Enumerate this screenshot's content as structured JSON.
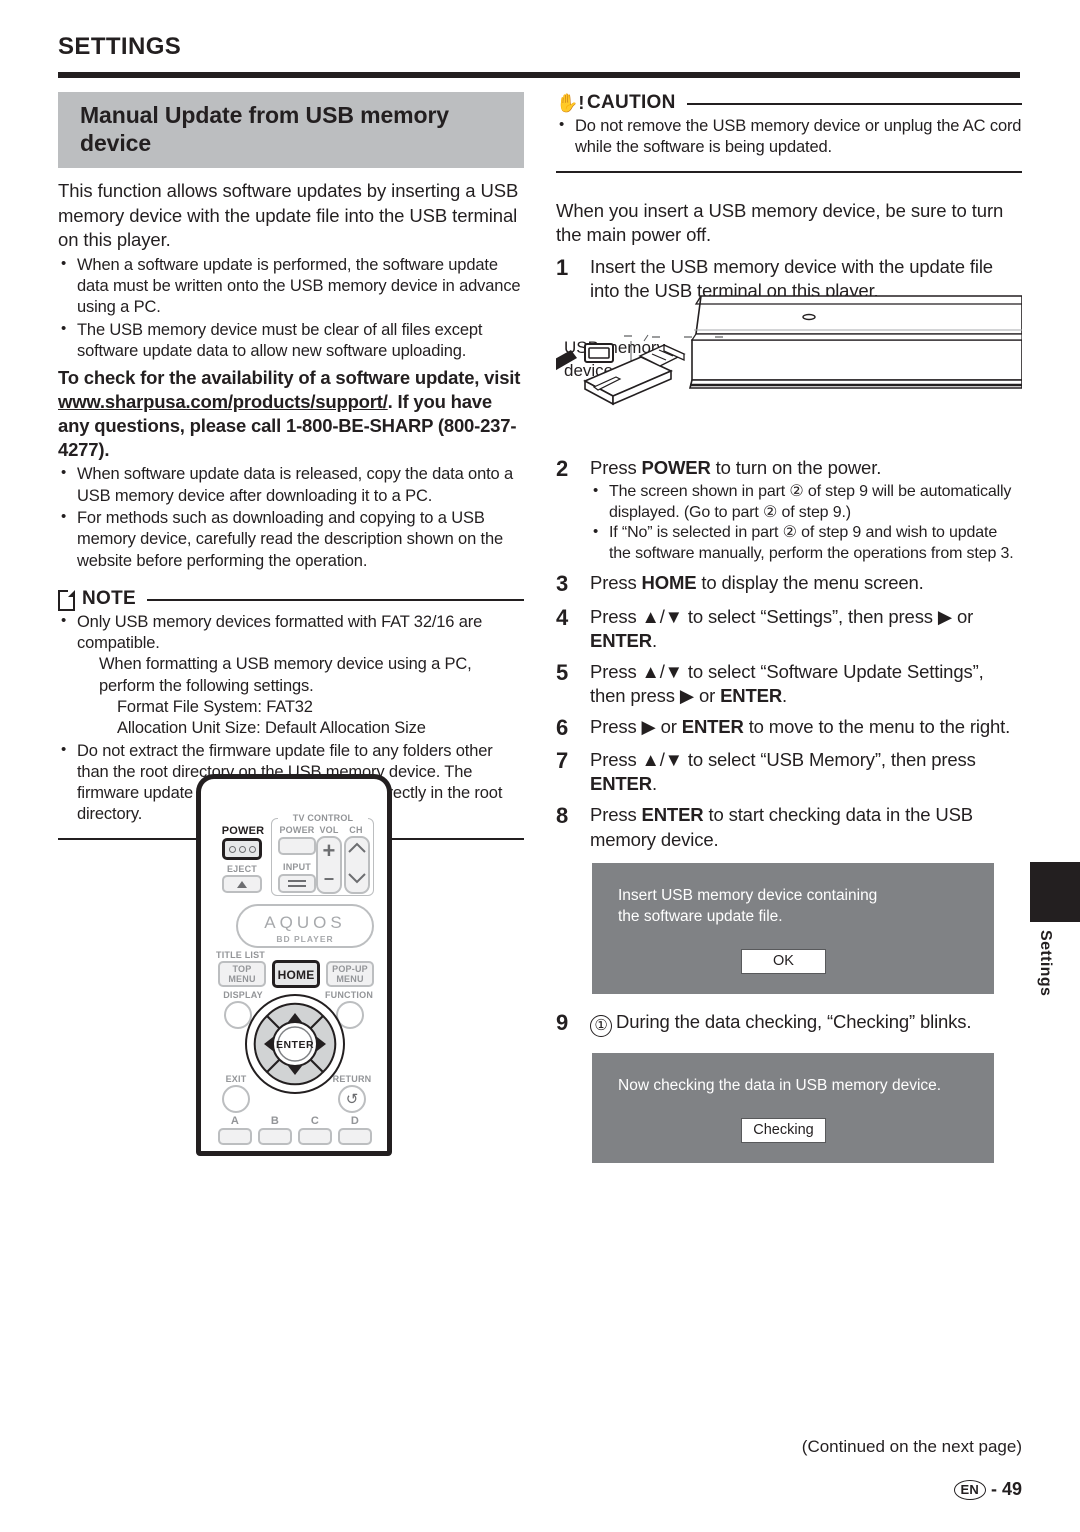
{
  "header": {
    "section_title": "SETTINGS"
  },
  "left": {
    "banner_title": "Manual Update from USB memory device",
    "intro": "This function allows software updates by inserting a USB memory device with the update file into the USB terminal on this player.",
    "intro_bullets": [
      "When a software update is performed, the software update data must be written onto the USB memory device in advance using a PC.",
      "The USB memory device must be clear of all files except software update data to allow new software uploading."
    ],
    "bold_notice_pre": "To check for the availability of a software update, visit ",
    "bold_notice_link": "www.sharpusa.com/products/support/",
    "bold_notice_post": ". If you have any questions, please call 1-800-BE-SHARP (800-237-4277).",
    "after_bullets": [
      "When software update data is released, copy the data onto a USB memory device after downloading it to a PC.",
      "For methods such as downloading and copying to a USB memory device, carefully read the description shown on the website before performing the operation."
    ],
    "note_label": "NOTE",
    "note_bullet_1_a": "Only USB memory devices formatted with FAT 32/16 are compatible.",
    "note_bullet_1_b": "When formatting a USB memory device using a PC, perform the following settings.",
    "note_bullet_1_c": "Format File System: FAT32",
    "note_bullet_1_d": "Allocation Unit Size: Default Allocation Size",
    "note_bullet_2": "Do not extract the firmware update file to any folders other than the root directory on the USB memory device. The firmware update file must be only one file directly in the root directory."
  },
  "remote": {
    "power_label": "POWER",
    "eject_label": "EJECT",
    "tv_control_label": "TV CONTROL",
    "tv_power_label": "POWER",
    "tv_vol_label": "VOL",
    "tv_ch_label": "CH",
    "input_label": "INPUT",
    "brand": "AQUOS",
    "brand_sub": "BD PLAYER",
    "title_list_label": "TITLE LIST",
    "top_menu_label_1": "TOP",
    "top_menu_label_2": "MENU",
    "home_label": "HOME",
    "popup_label_1": "POP-UP",
    "popup_label_2": "MENU",
    "display_label": "DISPLAY",
    "function_label": "FUNCTION",
    "enter_label": "ENTER",
    "exit_label": "EXIT",
    "return_label": "RETURN",
    "color_buttons": [
      "A",
      "B",
      "C",
      "D"
    ],
    "vol_plus": "+",
    "vol_minus": "−"
  },
  "right": {
    "caution_label": "CAUTION",
    "caution_bullet": "Do not remove the USB memory device or unplug the AC cord while the software is being updated.",
    "intro": "When you insert a USB memory device, be sure to turn the main power off.",
    "usb_caption_line1": "USB memory",
    "usb_caption_line2": "device",
    "steps": [
      {
        "num": "1",
        "text_parts": [
          {
            "t": "Insert the USB memory device with the update file into the USB terminal on this player.",
            "b": false
          }
        ],
        "bullets": []
      },
      {
        "num": "2",
        "text_parts": [
          {
            "t": "Press ",
            "b": false
          },
          {
            "t": "POWER",
            "b": true
          },
          {
            "t": " to turn on the power.",
            "b": false
          }
        ],
        "bullets": [
          "The screen shown in part ② of step 9 will be automatically displayed. (Go to part ② of step 9.)",
          "If “No” is selected in part ② of step 9 and wish to update the software manually, perform the operations from step 3."
        ]
      },
      {
        "num": "3",
        "text_parts": [
          {
            "t": "Press ",
            "b": false
          },
          {
            "t": "HOME",
            "b": true
          },
          {
            "t": " to display the menu screen.",
            "b": false
          }
        ],
        "bullets": []
      },
      {
        "num": "4",
        "text_parts": [
          {
            "t": "Press ▲/▼ to select “Settings”, then press ▶ or ",
            "b": false
          },
          {
            "t": "ENTER",
            "b": true
          },
          {
            "t": ".",
            "b": false
          }
        ],
        "bullets": []
      },
      {
        "num": "5",
        "text_parts": [
          {
            "t": "Press ▲/▼ to select “Software Update Settings”, then press ▶ or ",
            "b": false
          },
          {
            "t": "ENTER",
            "b": true
          },
          {
            "t": ".",
            "b": false
          }
        ],
        "bullets": []
      },
      {
        "num": "6",
        "text_parts": [
          {
            "t": "Press ▶ or ",
            "b": false
          },
          {
            "t": "ENTER",
            "b": true
          },
          {
            "t": " to move to the menu to the right.",
            "b": false
          }
        ],
        "bullets": []
      },
      {
        "num": "7",
        "text_parts": [
          {
            "t": "Press ▲/▼ to select “USB Memory”, then press ",
            "b": false
          },
          {
            "t": "ENTER",
            "b": true
          },
          {
            "t": ".",
            "b": false
          }
        ],
        "bullets": []
      },
      {
        "num": "8",
        "text_parts": [
          {
            "t": "Press ",
            "b": false
          },
          {
            "t": "ENTER",
            "b": true
          },
          {
            "t": " to start checking data in the USB memory device.",
            "b": false
          }
        ],
        "bullets": []
      }
    ],
    "osd1": {
      "line1": "Insert USB memory device containing",
      "line2": "the software update file.",
      "button": "OK"
    },
    "step9": {
      "num": "9",
      "circled": "①",
      "text": "During the data checking, “Checking” blinks."
    },
    "osd2": {
      "line1": "Now checking the data in USB memory device.",
      "button": "Checking"
    }
  },
  "side_tab": {
    "label": "Settings"
  },
  "footer": {
    "continued": "(Continued on the next page)",
    "lang": "EN",
    "dash": "-",
    "page": "49"
  }
}
